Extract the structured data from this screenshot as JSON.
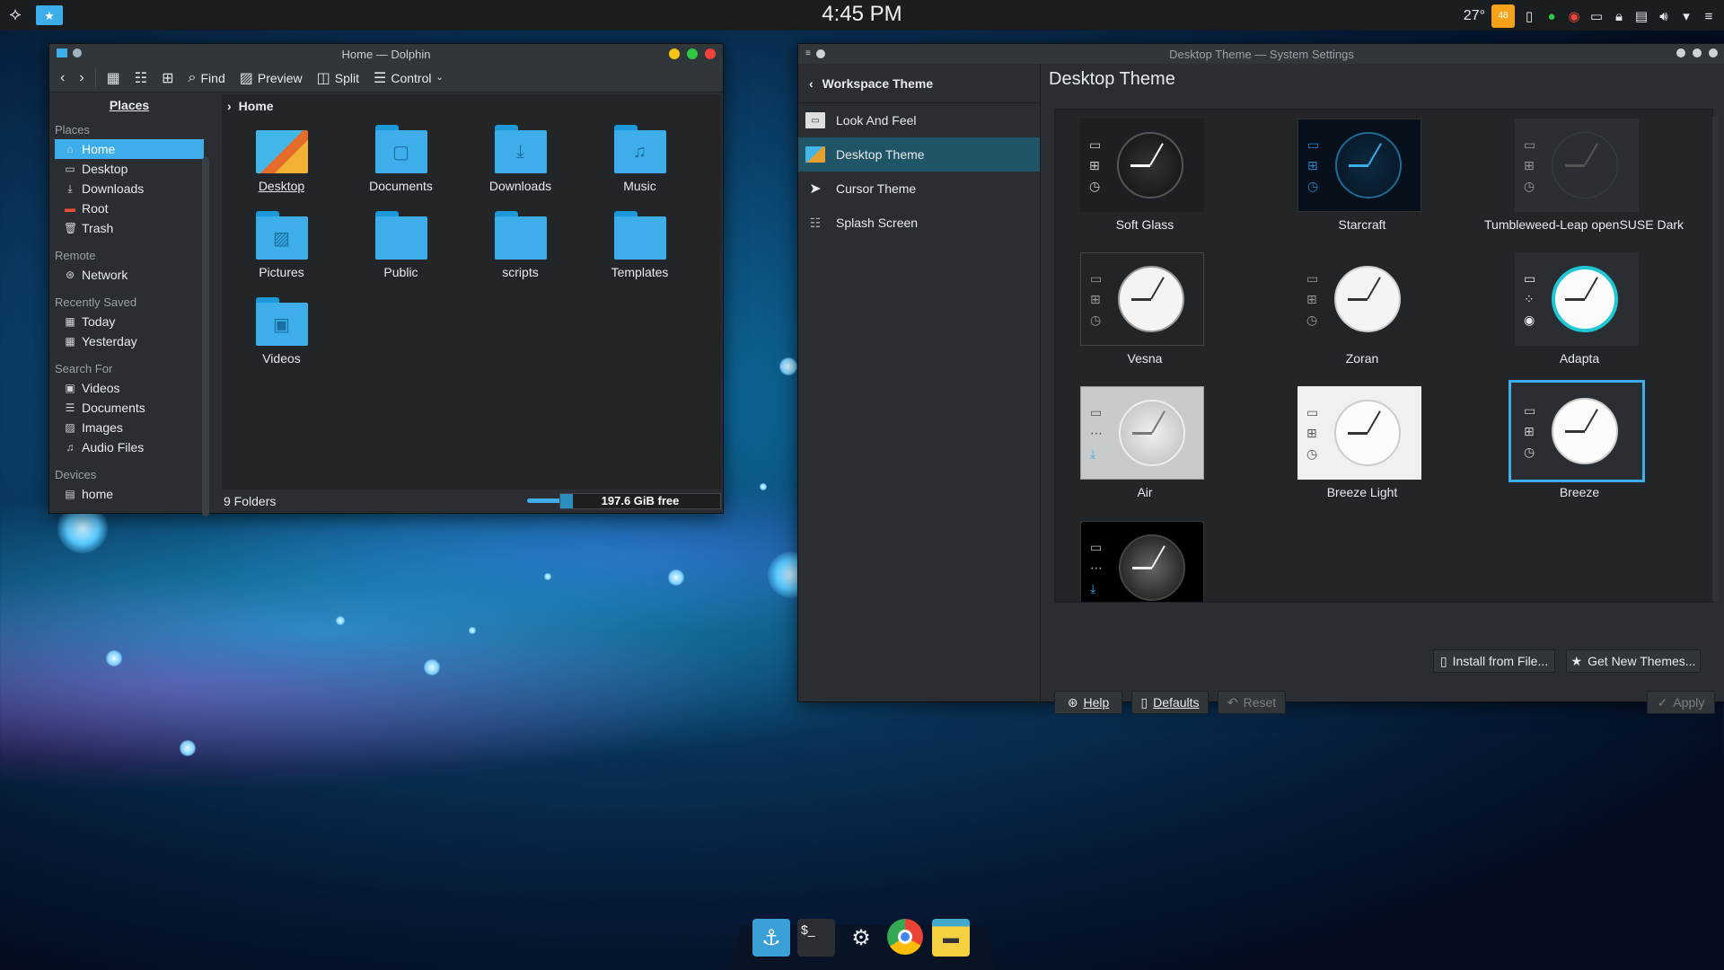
{
  "panel": {
    "clock": "4:45 PM",
    "temp": "27°",
    "sun_badge": "48",
    "launcher_icon": "kde-kicker-icon"
  },
  "dolphin": {
    "title": "Home — Dolphin",
    "toolbar": {
      "find": "Find",
      "preview": "Preview",
      "split": "Split",
      "control": "Control"
    },
    "places_tab": "Places",
    "sections": [
      {
        "head": "Places",
        "items": [
          "Home",
          "Desktop",
          "Downloads",
          "Root",
          "Trash"
        ]
      },
      {
        "head": "Remote",
        "items": [
          "Network"
        ]
      },
      {
        "head": "Recently Saved",
        "items": [
          "Today",
          "Yesterday"
        ]
      },
      {
        "head": "Search For",
        "items": [
          "Videos",
          "Documents",
          "Images",
          "Audio Files"
        ]
      },
      {
        "head": "Devices",
        "items": [
          "home"
        ]
      }
    ],
    "breadcrumb": "Home",
    "folders": [
      "Desktop",
      "Documents",
      "Downloads",
      "Music",
      "Pictures",
      "Public",
      "scripts",
      "Templates",
      "Videos"
    ],
    "status": "9 Folders",
    "free_space": "197.6 GiB free",
    "free_space_used_fraction": 0.08,
    "zoom_fraction": 0.25
  },
  "settings": {
    "title": "Desktop Theme — System Settings",
    "back_label": "Workspace Theme",
    "nav": [
      "Look And Feel",
      "Desktop Theme",
      "Cursor Theme",
      "Splash Screen"
    ],
    "heading": "Desktop Theme",
    "themes": [
      "Soft Glass",
      "Starcraft",
      "Tumbleweed-Leap openSUSE Dark",
      "Vesna",
      "Zoran",
      "Adapta",
      "Air",
      "Breeze Light",
      "Breeze",
      ""
    ],
    "selected_theme": "Breeze",
    "buttons": {
      "install": "Install from File...",
      "get_new": "Get New Themes...",
      "help": "Help",
      "defaults": "Defaults",
      "reset": "Reset",
      "apply": "Apply"
    }
  },
  "colors": {
    "accent": "#3daee9",
    "panel": "#1b1e21",
    "window": "#2a2e32"
  }
}
